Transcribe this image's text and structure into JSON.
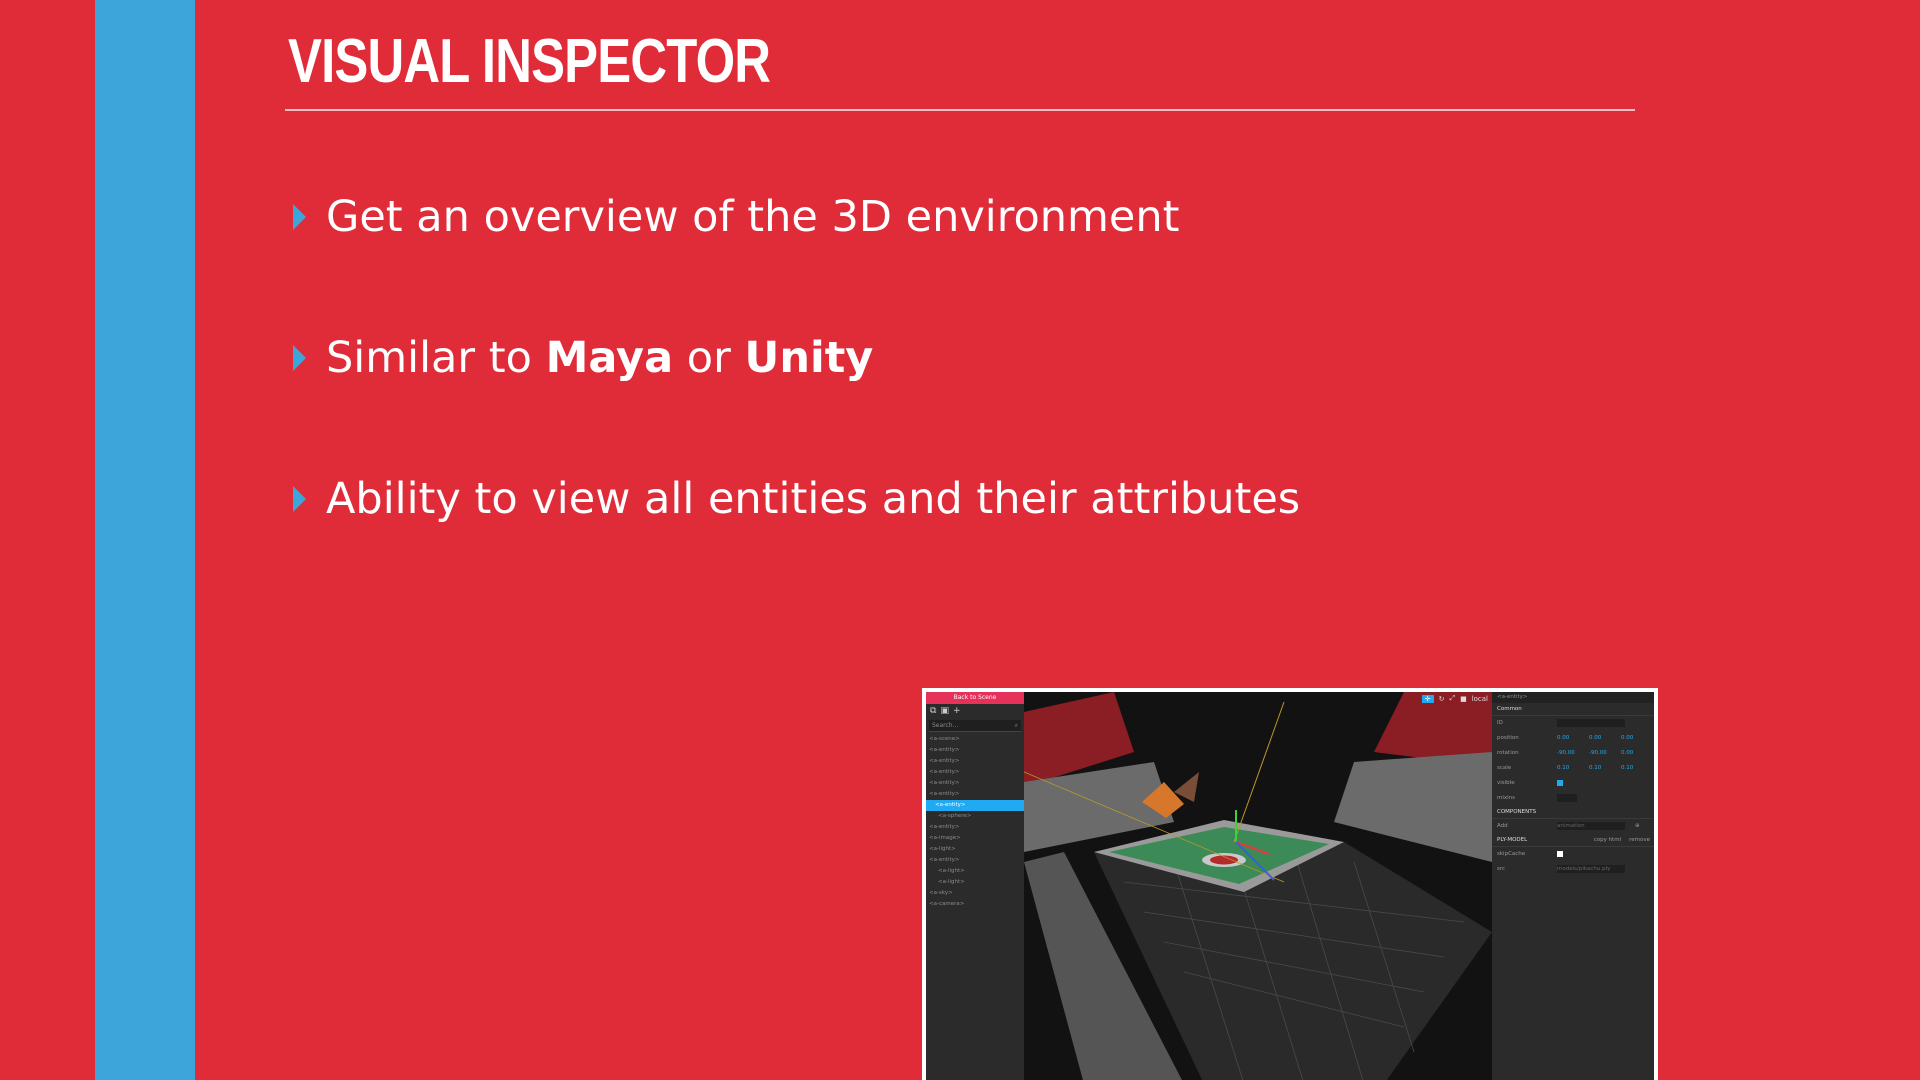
{
  "slide": {
    "title": "VISUAL INSPECTOR",
    "bullets": [
      {
        "text": "Get an overview of the 3D environment"
      },
      {
        "pre": "Similar to ",
        "b1": "Maya",
        "mid": " or ",
        "b2": "Unity"
      },
      {
        "text": "Ability to view all entities and their attributes"
      }
    ]
  },
  "colors": {
    "background": "#e02b39",
    "stripe": "#3da5d9",
    "text": "#ffffff",
    "accent": "#1faaf2"
  },
  "inspector": {
    "back_label": "Back to Scene",
    "search_placeholder": "Search...",
    "tree": [
      "<a-scene>",
      "<a-entity>",
      "<a-entity>",
      "<a-entity>",
      "<a-entity>",
      "<a-entity>",
      "<a-entity>",
      "<a-sphere>",
      "<a-entity>",
      "<a-image>",
      "<a-light>",
      "<a-entity>",
      "<a-light>",
      "<a-light>",
      "<a-sky>",
      "<a-camera>"
    ],
    "toolbar": {
      "local_label": "local"
    },
    "entity_header": "<a-entity>",
    "sections": {
      "common": "Common",
      "components": "COMPONENTS",
      "model": "PLY-MODEL"
    },
    "rows": [
      {
        "label": "ID",
        "values": []
      },
      {
        "label": "position",
        "values": [
          "0.00",
          "0.00",
          "0.00"
        ]
      },
      {
        "label": "rotation",
        "values": [
          "-90.00",
          "-90.00",
          "0.00"
        ]
      },
      {
        "label": "scale",
        "values": [
          "0.10",
          "0.10",
          "0.10"
        ]
      },
      {
        "label": "visible",
        "values": []
      },
      {
        "label": "mixins",
        "values": []
      }
    ],
    "add_label": "Add",
    "add_select": "animation",
    "model_actions": [
      "copy html",
      "remove"
    ],
    "model_rows": [
      {
        "label": "skipCache"
      },
      {
        "label": "src",
        "value": "models/pikachu.ply"
      }
    ]
  }
}
